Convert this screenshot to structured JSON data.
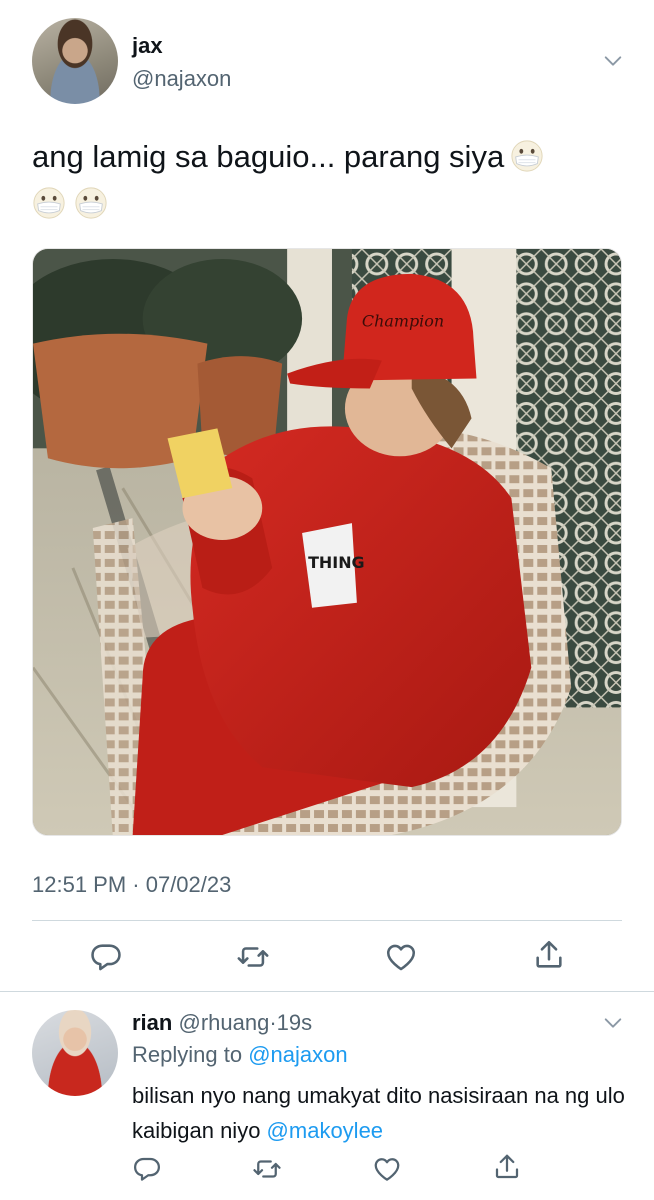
{
  "tweet": {
    "display_name": "jax",
    "handle": "@najaxon",
    "text": "ang lamig sa baguio... parang siya",
    "emoji": "face-with-medical-mask",
    "timestamp": "12:51 PM · 07/02/23",
    "actions": [
      "reply-icon",
      "retweet-icon",
      "like-icon",
      "share-icon"
    ]
  },
  "reply": {
    "display_name": "rian",
    "handle": "@rhuang",
    "separator": "·",
    "time_ago": "19s",
    "replying_prefix": "Replying to ",
    "replying_to": "@najaxon",
    "text": "bilisan nyo nang umakyat dito nasisiraan na ng ulo kaibigan niyo ",
    "mention": "@makoylee",
    "actions": [
      "reply-icon",
      "retweet-icon",
      "like-icon",
      "share-icon"
    ]
  },
  "colors": {
    "text_primary": "#0f1419",
    "text_secondary": "#536471",
    "link": "#1d9bf0",
    "divider": "#cfd9de"
  }
}
